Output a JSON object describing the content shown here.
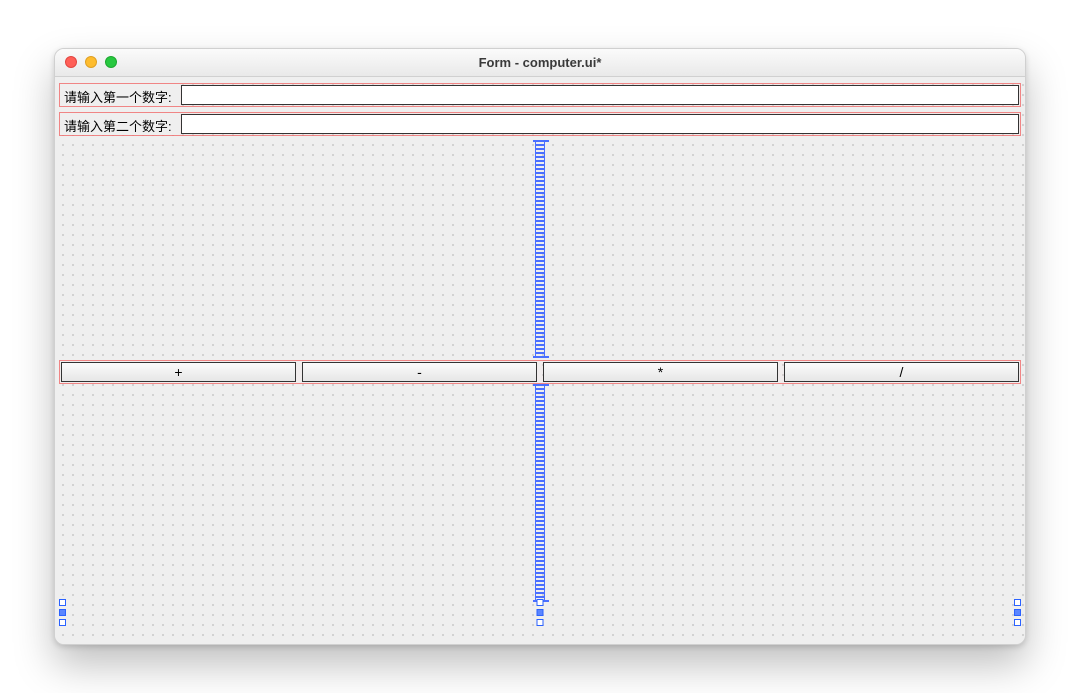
{
  "window": {
    "title": "Form - computer.ui*"
  },
  "labels": {
    "num1": "请输入第一个数字:",
    "num2": "请输入第二个数字:"
  },
  "inputs": {
    "num1_value": "",
    "num2_value": ""
  },
  "buttons": {
    "add": "+",
    "sub": "-",
    "mul": "*",
    "div": "/"
  }
}
